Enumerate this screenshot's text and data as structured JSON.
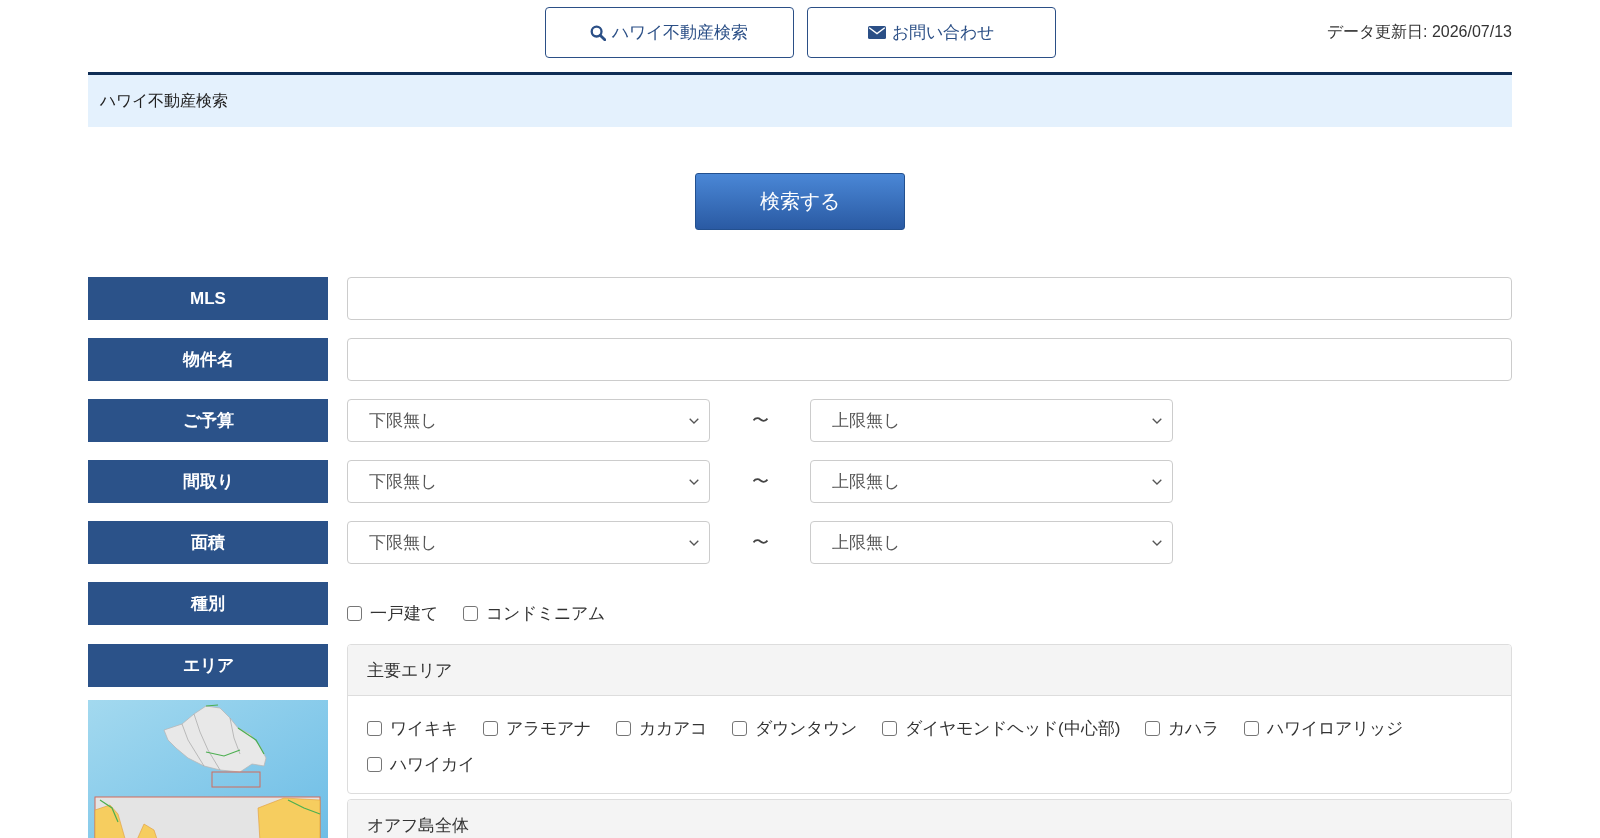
{
  "header": {
    "nav_buttons": [
      {
        "kind": "search",
        "label": "ハワイ不動産検索"
      },
      {
        "kind": "contact",
        "label": "お問い合わせ"
      }
    ],
    "updated": "データ更新日: 2026/07/13"
  },
  "breadcrumb": "ハワイ不動産検索",
  "search_button": "検索する",
  "fields": [
    {
      "kind": "text",
      "label": "MLS"
    },
    {
      "kind": "text",
      "label": "物件名"
    },
    {
      "kind": "range",
      "label": "ご予算",
      "min": "下限無し",
      "separator": "〜",
      "max": "上限無し"
    },
    {
      "kind": "range",
      "label": "間取り",
      "min": "下限無し",
      "separator": "〜",
      "max": "上限無し"
    },
    {
      "kind": "range",
      "label": "面積",
      "min": "下限無し",
      "separator": "〜",
      "max": "上限無し"
    },
    {
      "kind": "checkboxes",
      "label": "種別",
      "options": [
        {
          "label": "一戸建て",
          "checked": false
        },
        {
          "label": "コンドミニアム",
          "checked": false
        }
      ]
    }
  ],
  "area": {
    "label": "エリア",
    "groups": [
      {
        "title": "主要エリア",
        "options": [
          {
            "label": "ワイキキ",
            "checked": false
          },
          {
            "label": "アラモアナ",
            "checked": false
          },
          {
            "label": "カカアコ",
            "checked": false
          },
          {
            "label": "ダウンタウン",
            "checked": false
          },
          {
            "label": "ダイヤモンドヘッド(中心部)",
            "checked": false
          },
          {
            "label": "カハラ",
            "checked": false
          },
          {
            "label": "ハワイロアリッジ",
            "checked": false
          },
          {
            "label": "ハワイカイ",
            "checked": false
          }
        ]
      },
      {
        "title": "オアフ島全体"
      }
    ]
  }
}
